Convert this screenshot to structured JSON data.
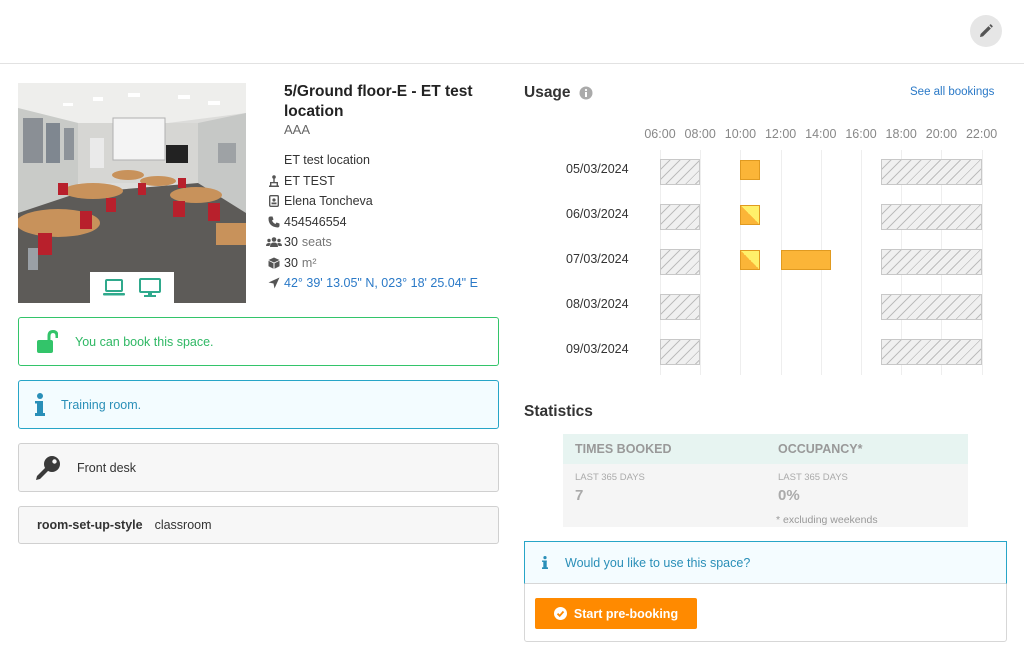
{
  "header": {
    "edit_icon": "pencil-icon"
  },
  "room": {
    "title": "5/Ground floor-E - ET test location",
    "code": "AAA",
    "location": "ET test location",
    "department": "ET TEST",
    "owner": "Elena Toncheva",
    "phone": "454546554",
    "seats_value": "30",
    "seats_unit": "seats",
    "area_value": "30",
    "area_unit": "m²",
    "coordinates": "42° 39' 13.05\" N, 023° 18' 25.04\" E",
    "equipment_icons": [
      "laptop-icon",
      "monitor-icon"
    ]
  },
  "notices": {
    "bookable": "You can book this space.",
    "training": "Training room.",
    "access": "Front desk"
  },
  "property": {
    "key": "room-set-up-style",
    "value": "classroom"
  },
  "usage": {
    "title": "Usage",
    "see_all": "See all bookings",
    "hours": [
      "06:00",
      "08:00",
      "10:00",
      "12:00",
      "14:00",
      "16:00",
      "18:00",
      "20:00",
      "22:00"
    ],
    "days": [
      {
        "date": "05/03/2024",
        "bookings": [
          {
            "start": 10.0,
            "end": 11.0,
            "style": "full"
          }
        ]
      },
      {
        "date": "06/03/2024",
        "bookings": [
          {
            "start": 10.0,
            "end": 11.0,
            "style": "half"
          }
        ]
      },
      {
        "date": "07/03/2024",
        "bookings": [
          {
            "start": 10.0,
            "end": 11.0,
            "style": "half"
          },
          {
            "start": 12.0,
            "end": 14.5,
            "style": "full"
          }
        ]
      },
      {
        "date": "08/03/2024",
        "bookings": []
      },
      {
        "date": "09/03/2024",
        "bookings": []
      }
    ],
    "closed_ranges": [
      {
        "start": 6.0,
        "end": 8.0
      },
      {
        "start": 17.0,
        "end": 22.0
      }
    ],
    "colors": {
      "booked": "#fbb538",
      "tentative": "#fff06a"
    }
  },
  "statistics": {
    "title": "Statistics",
    "times_booked_label": "TIMES BOOKED",
    "occupancy_label": "OCCUPANCY*",
    "period_label": "LAST 365 DAYS",
    "times_booked_value": "7",
    "occupancy_value": "0%",
    "note": "* excluding weekends"
  },
  "prebook": {
    "question": "Would you like to use this space?",
    "button": "Start pre-booking"
  },
  "colors": {
    "accent": "#ff8a00",
    "success": "#2fb864",
    "info": "#2a8fb8",
    "link": "#2a79c7"
  }
}
